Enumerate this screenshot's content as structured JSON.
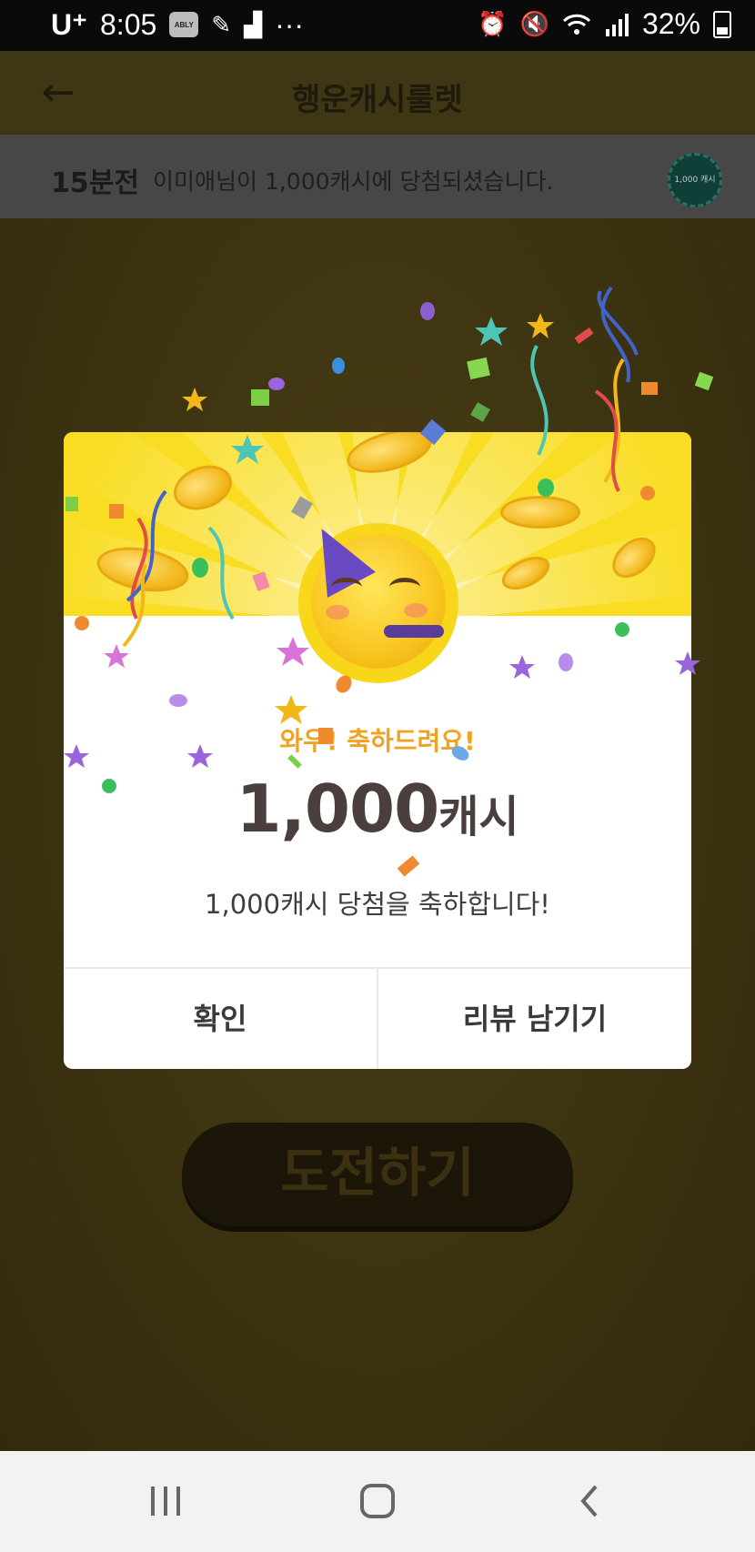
{
  "status_bar": {
    "carrier": "U⁺",
    "time": "8:05",
    "app_badge": "ABLY",
    "more": "···",
    "battery": "32%"
  },
  "header": {
    "title": "행운캐시룰렛",
    "back_icon": "arrow-left-icon"
  },
  "ticker": {
    "time": "15분전",
    "message": "이미애님이 1,000캐시에 당첨되셨습니다.",
    "chip_label": "1,000 캐시"
  },
  "modal": {
    "congrats": "와우! 축하드려요!",
    "amount": "1,000",
    "unit": "캐시",
    "description": "1,000캐시 당첨을 축하합니다!",
    "confirm_button": "확인",
    "review_button": "리뷰 남기기"
  },
  "challenge_button": "도전하기",
  "nav": {
    "recent_icon": "recent-apps-icon",
    "home_icon": "home-icon",
    "back_icon": "back-chevron-icon"
  },
  "colors": {
    "modal_header": "#f9dd23",
    "congrats_text": "#f0a323",
    "prize_text": "#4a3f3c"
  }
}
